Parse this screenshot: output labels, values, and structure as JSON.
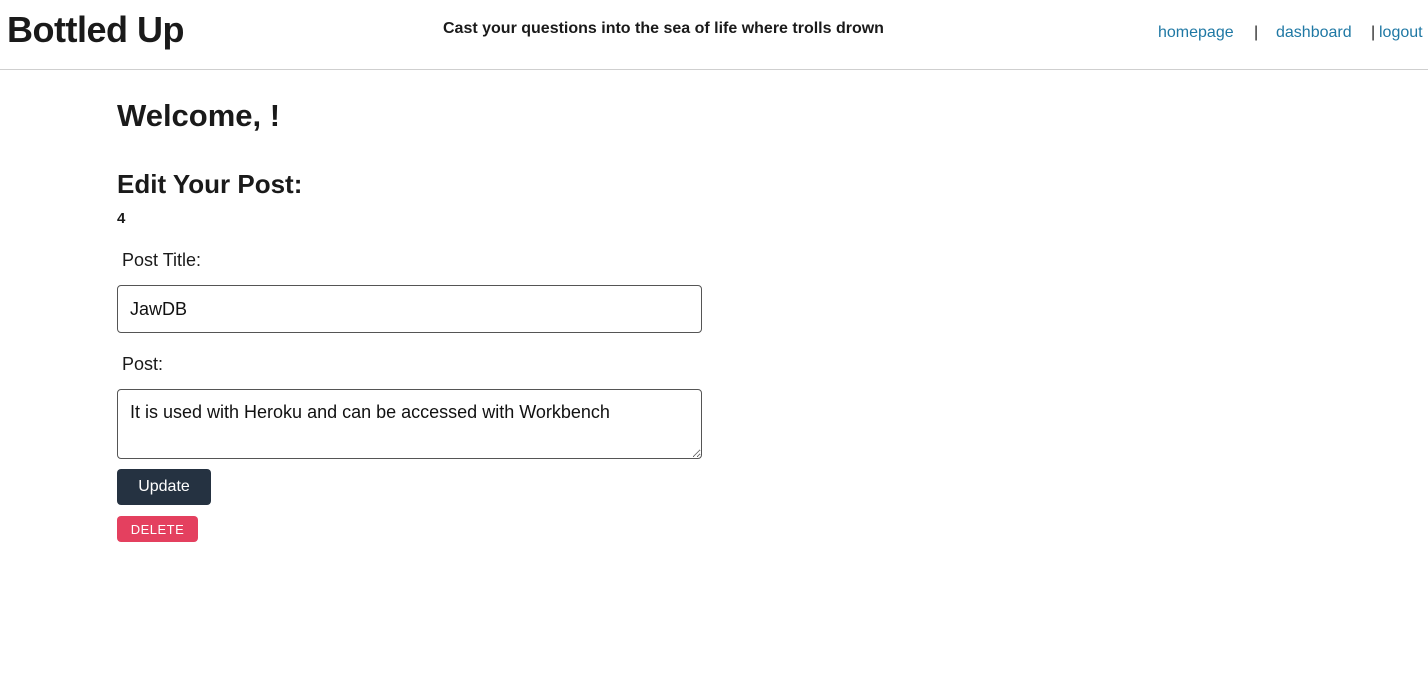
{
  "header": {
    "site_title": "Bottled Up",
    "tagline": "Cast your questions into the sea of life where trolls drown",
    "nav": {
      "homepage": "homepage",
      "separator_1": "|",
      "dashboard": "dashboard",
      "separator_2": "|",
      "logout": "logout"
    }
  },
  "main": {
    "welcome": "Welcome, !",
    "edit_heading": "Edit Your Post:",
    "post_id": "4",
    "title_label": "Post Title:",
    "title_value": "JawDB",
    "post_label": "Post:",
    "post_value": "It is used with Heroku and can be accessed with Workbench",
    "update_label": "Update",
    "delete_label": "DELETE"
  },
  "colors": {
    "link": "#1f78a4",
    "update_button": "#253241",
    "delete_button": "#e4405f"
  }
}
